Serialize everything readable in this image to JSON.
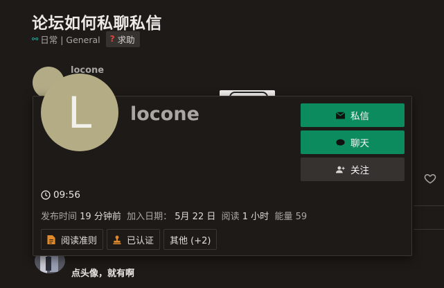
{
  "topic": {
    "title": "论坛如何私聊私信",
    "category": "日常 | General",
    "tag": "求助"
  },
  "post": {
    "username": "locone",
    "reply_text": "点头像，就有啊"
  },
  "user_card": {
    "avatar_letter": "L",
    "name": "locone",
    "buttons": {
      "message": "私信",
      "chat": "聊天",
      "follow": "关注"
    },
    "local_time": "09:56",
    "meta": {
      "posted_label": "发布时间",
      "posted_value": "19 分钟前",
      "joined_label": "加入日期：",
      "joined_value": "5月 22 日",
      "read_label": "阅读",
      "read_value": "1 小时",
      "energy_label": "能量",
      "energy_value": "59"
    },
    "badges": [
      "阅读准则",
      "已认证",
      "其他 (+2)"
    ]
  },
  "colors": {
    "background": "#1e1a17",
    "primary_button": "#0c8b5f",
    "secondary_button": "#353230",
    "avatar": "#b3ac85",
    "badge_icon": "#e08a2c"
  },
  "icons": [
    "link-icon",
    "question-icon",
    "envelope-icon",
    "chat-bubble-icon",
    "add-user-icon",
    "clock-icon",
    "document-icon",
    "stamp-icon",
    "heart-icon"
  ]
}
